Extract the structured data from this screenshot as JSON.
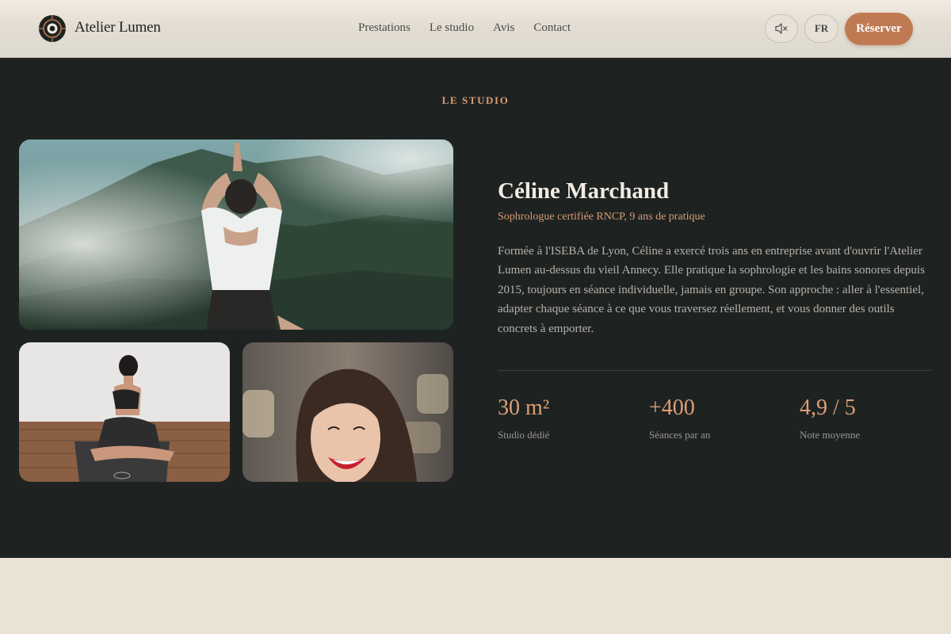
{
  "header": {
    "brand": "Atelier Lumen",
    "nav": [
      "Prestations",
      "Le studio",
      "Avis",
      "Contact"
    ],
    "sound_icon": "speaker-muted-icon",
    "lang_label": "FR",
    "book_label": "Réserver"
  },
  "studio": {
    "eyebrow": "LE STUDIO",
    "name": "Céline Marchand",
    "subtitle": "Sophrologue certifiée RNCP, 9 ans de pratique",
    "bio": "Formée à l'ISEBA de Lyon, Céline a exercé trois ans en entreprise avant d'ouvrir l'Atelier Lumen au-dessus du vieil Annecy. Elle pratique la sophrologie et les bains sonores depuis 2015, toujours en séance individuelle, jamais en groupe. Son approche : aller à l'essentiel, adapter chaque séance à ce que vous traversez réellement, et vous donner des outils concrets à emporter.",
    "stats": [
      {
        "value": "30 m²",
        "label": "Studio dédié"
      },
      {
        "value": "+400",
        "label": "Séances par an"
      },
      {
        "value": "4,9 / 5",
        "label": "Note moyenne"
      }
    ]
  },
  "colors": {
    "accent": "#c07a53",
    "accent_text": "#d99b72",
    "dark_bg": "#1e2322",
    "light_bg": "#ebe2d6"
  }
}
